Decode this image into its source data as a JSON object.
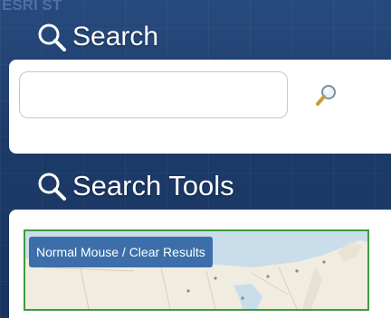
{
  "background_label": "ESRI ST",
  "search_panel": {
    "title": "Search",
    "input_value": "",
    "title_icon": "magnifier-icon",
    "button_icon": "magnifier-icon"
  },
  "tools_panel": {
    "title": "Search Tools",
    "title_icon": "magnifier-icon",
    "tool": {
      "label": "Normal Mouse / Clear Results",
      "thumbnail": "us-map-thumbnail",
      "selected_border_color": "#3f9a3f"
    }
  },
  "colors": {
    "panel_background": "#1e3a66",
    "label_background": "#3c6faa",
    "search_button": "#c89b3c"
  }
}
